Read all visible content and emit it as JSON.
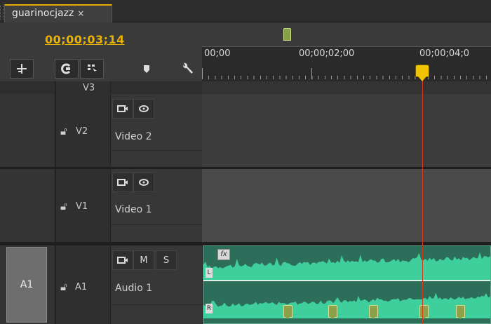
{
  "tab": {
    "title": "guarinocjazz",
    "close_glyph": "×"
  },
  "timecode": "00;00;03;14",
  "ruler": {
    "labels": [
      "00;00",
      "00;00;02;00",
      "00;00;04;0"
    ]
  },
  "tools": [
    {
      "name": "snap-tool",
      "icon": "snap-icon"
    },
    {
      "name": "linked-selection",
      "icon": "link-icon"
    },
    {
      "name": "add-marker",
      "icon": "marker-icon"
    },
    {
      "name": "marker-flag",
      "icon": "marker-flag-icon"
    },
    {
      "name": "timeline-settings",
      "icon": "wrench-icon"
    }
  ],
  "tracks": {
    "v3": {
      "label": "V3"
    },
    "v2": {
      "label": "V2",
      "name": "Video 2"
    },
    "v1": {
      "label": "V1",
      "name": "Video 1"
    },
    "a1": {
      "source": "A1",
      "label": "A1",
      "name": "Audio 1",
      "mute": "M",
      "solo": "S"
    }
  },
  "clip": {
    "left_channel": "L",
    "right_channel": "R",
    "fx": "fx"
  },
  "colors": {
    "accent": "#e8a800",
    "playhead": "#d63a1c",
    "audio_clip": "#2c6e5a",
    "waveform": "#3ecf9c",
    "marker": "#8ea04a"
  }
}
